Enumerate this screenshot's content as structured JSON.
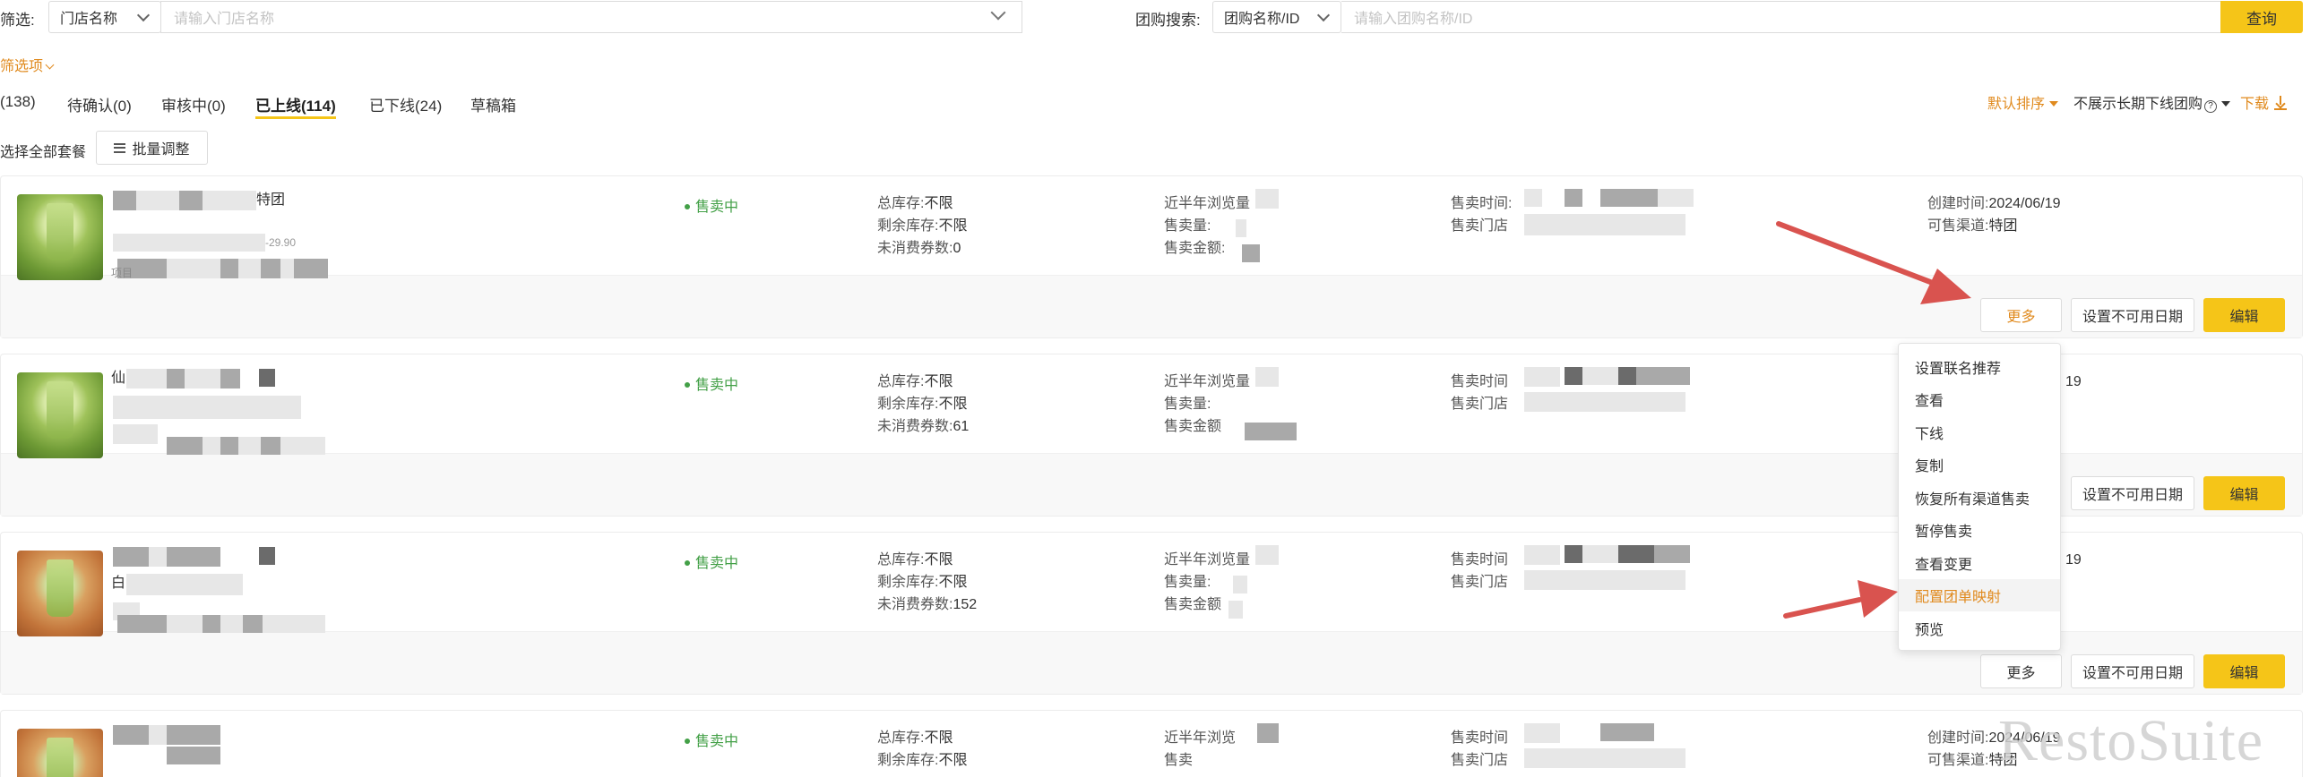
{
  "filters": {
    "label": "筛选:",
    "store_select": "门店名称",
    "store_placeholder": "请输入门店名称",
    "group_label": "团购搜索:",
    "group_select": "团购名称/ID",
    "group_placeholder": "请输入团购名称/ID",
    "query_button": "查询",
    "more_filters": "筛选项"
  },
  "tabs": [
    {
      "label": "(138)"
    },
    {
      "label": "待确认(0)"
    },
    {
      "label": "审核中(0)"
    },
    {
      "label": "已上线(114)",
      "active": true
    },
    {
      "label": "已下线(24)"
    },
    {
      "label": "草稿箱"
    }
  ],
  "toolbar": {
    "sort": "默认排序",
    "hide_offline": "不展示长期下线团购",
    "download": "下载",
    "select_all": "选择全部套餐",
    "batch_adjust": "批量调整"
  },
  "cards": [
    {
      "title_fragment": "特团",
      "price_fragment": "-29.90",
      "item_fragment": "项目",
      "status": "售卖中",
      "stock": {
        "total_label": "总库存:",
        "total": "不限",
        "remain_label": "剩余库存:",
        "remain": "不限",
        "unused_label": "未消费券数:",
        "unused": "0"
      },
      "stats": {
        "views_label": "近半年浏览量",
        "sold_label": "售卖量:",
        "amount_label": "售卖金额:"
      },
      "sale": {
        "time_label": "售卖时间:",
        "store_label": "售卖门店"
      },
      "meta": {
        "created_label": "创建时间:",
        "created": "2024/06/19",
        "channel_label": "可售渠道:",
        "channel": "特团"
      },
      "buttons": {
        "more": "更多",
        "unavailable": "设置不可用日期",
        "edit": "编辑"
      }
    },
    {
      "title_fragment": "仙",
      "status": "售卖中",
      "stock": {
        "total_label": "总库存:",
        "total": "不限",
        "remain_label": "剩余库存:",
        "remain": "不限",
        "unused_label": "未消费券数:",
        "unused": "61"
      },
      "stats": {
        "views_label": "近半年浏览量",
        "sold_label": "售卖量:",
        "amount_label": "售卖金额"
      },
      "sale": {
        "time_label": "售卖时间",
        "store_label": "售卖门店"
      },
      "meta": {
        "created_suffix": "19"
      },
      "buttons": {
        "unavailable": "设置不可用日期",
        "edit": "编辑"
      }
    },
    {
      "title_fragment": "白",
      "status": "售卖中",
      "stock": {
        "total_label": "总库存:",
        "total": "不限",
        "remain_label": "剩余库存:",
        "remain": "不限",
        "unused_label": "未消费券数:",
        "unused": "152"
      },
      "stats": {
        "views_label": "近半年浏览量",
        "sold_label": "售卖量:",
        "amount_label": "售卖金额"
      },
      "sale": {
        "time_label": "售卖时间",
        "store_label": "售卖门店"
      },
      "meta": {
        "created_suffix": "19"
      },
      "buttons": {
        "more": "更多",
        "unavailable": "设置不可用日期",
        "edit": "编辑"
      }
    },
    {
      "status": "售卖中",
      "stock": {
        "total_label": "总库存:",
        "total": "不限",
        "remain_label": "剩余库存:",
        "remain": "不限"
      },
      "stats": {
        "views_label": "近半年浏览",
        "sold_label": "售卖"
      },
      "sale": {
        "time_label": "售卖时间",
        "store_label": "售卖门店"
      },
      "meta": {
        "created_label": "创建时间:",
        "created": "2024/06/19",
        "channel_label": "可售渠道:",
        "channel": "特团"
      }
    }
  ],
  "menu": {
    "items": [
      {
        "label": "设置联名推荐"
      },
      {
        "label": "查看"
      },
      {
        "label": "下线"
      },
      {
        "label": "复制"
      },
      {
        "label": "恢复所有渠道售卖"
      },
      {
        "label": "暂停售卖"
      },
      {
        "label": "查看变更"
      },
      {
        "label": "配置团单映射",
        "highlighted": true
      },
      {
        "label": "预览"
      }
    ]
  },
  "watermark": "RestoSuite",
  "colors": {
    "accent": "#f5c518",
    "link": "#e08a1e",
    "status_green": "#43a047",
    "annotation_arrow": "#d9534f"
  }
}
